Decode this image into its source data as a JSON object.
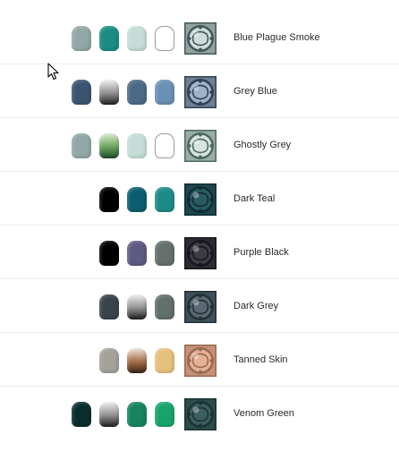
{
  "paints": [
    {
      "name": "Blue Plague Smoke",
      "pots": [
        "#93a8a6",
        "#1a8c82",
        "#c5ddd7",
        "outline"
      ],
      "thumb": "#cfdcda",
      "thumb_dark": "#435a58"
    },
    {
      "name": "Grey Blue",
      "pots": [
        "#3b5470",
        "gradient-grey",
        "#4c6a85",
        "#6b90b6"
      ],
      "thumb": "#9fb2c6",
      "thumb_dark": "#2f4255"
    },
    {
      "name": "Ghostly Grey",
      "pots": [
        "#93a8a6",
        "gradient-green",
        "#c5ddd7",
        "outline"
      ],
      "thumb": "#d7e4e0",
      "thumb_dark": "#4d6b63"
    },
    {
      "name": "Dark Teal",
      "pots": [
        "#000000",
        "#0b5e6e",
        "#1d8c86"
      ],
      "thumb": "#2a5b64",
      "thumb_dark": "#0f2d33"
    },
    {
      "name": "Purple Black",
      "pots": [
        "#000000",
        "#5e5a82",
        "#65706a"
      ],
      "thumb": "#3d3c45",
      "thumb_dark": "#17171c"
    },
    {
      "name": "Dark Grey",
      "pots": [
        "#38444a",
        "gradient-grey",
        "#62706a"
      ],
      "thumb": "#5b6a72",
      "thumb_dark": "#233038"
    },
    {
      "name": "Tanned Skin",
      "pots": [
        "#a3a19a",
        "gradient-brown",
        "#e6c17e"
      ],
      "thumb": "#e6b297",
      "thumb_dark": "#9a6a52"
    },
    {
      "name": "Venom Green",
      "pots": [
        "#0b2d2e",
        "gradient-grey",
        "#16845f",
        "#18a36a"
      ],
      "thumb": "#3c5e5e",
      "thumb_dark": "#1c3334"
    }
  ]
}
